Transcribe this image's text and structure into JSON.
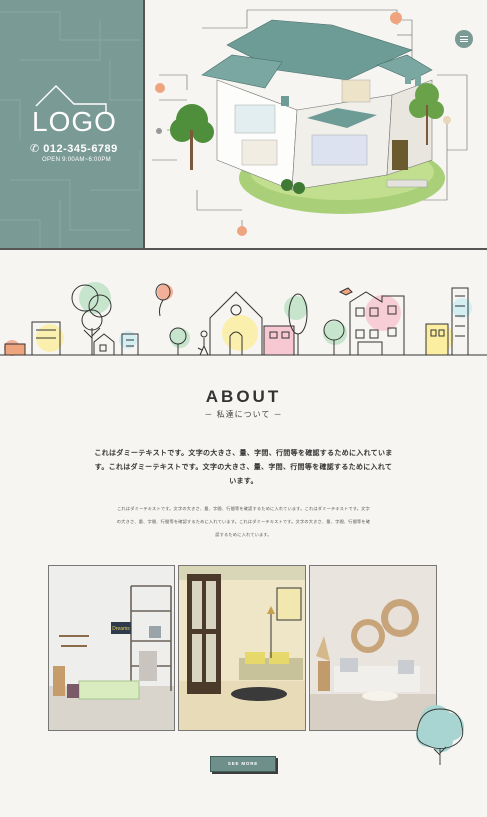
{
  "brand": {
    "logo_text": "LOGO",
    "phone": "012-345-6789",
    "hours": "OPEN 9:00AM~6:00PM"
  },
  "about": {
    "title": "ABOUT",
    "subtitle": "－ 私達について －",
    "lead": "これはダミーテキストです。文字の大きさ、量、字間、行間等を確認するために入れています。これはダミーテキストです。文字の大きさ、量、字間、行間等を確認するために入れています。",
    "body": "これはダミーテキストです。文字の大きさ、量、字間、行間等を確認するために入れています。これはダミーテキストです。文字の大きさ、量、字間、行間等を確認するために入れています。これはダミーテキストです。文字の大きさ、量、字間、行間等を確認するために入れています。"
  },
  "photos": [
    {
      "name": "interior-photo-1",
      "sign": "Dreams"
    },
    {
      "name": "interior-photo-2"
    },
    {
      "name": "interior-photo-3"
    }
  ],
  "cta": {
    "see_more": "SEE MORE"
  },
  "colors": {
    "brand": "#7a9a95",
    "accent_orange": "#eea47f",
    "background": "#f7f5f1"
  },
  "icons": [
    "phone-icon",
    "menu-icon",
    "house-icon"
  ]
}
